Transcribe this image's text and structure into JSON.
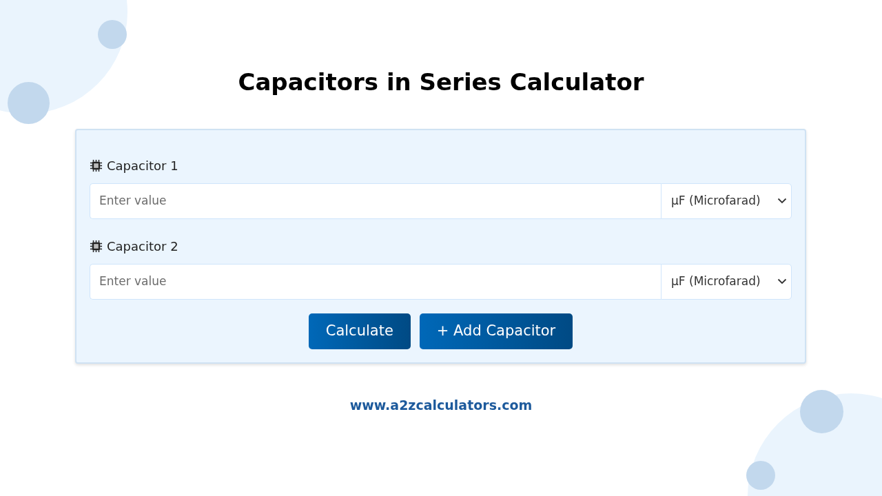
{
  "title": "Capacitors in Series Calculator",
  "capacitors": [
    {
      "label": "Capacitor 1",
      "placeholder": "Enter value",
      "unit": "µF (Microfarad)"
    },
    {
      "label": "Capacitor 2",
      "placeholder": "Enter value",
      "unit": "µF (Microfarad)"
    }
  ],
  "buttons": [
    {
      "label": "Calculate"
    },
    {
      "label": "+ Add Capacitor"
    }
  ],
  "footer": "www.a2zcalculators.com"
}
